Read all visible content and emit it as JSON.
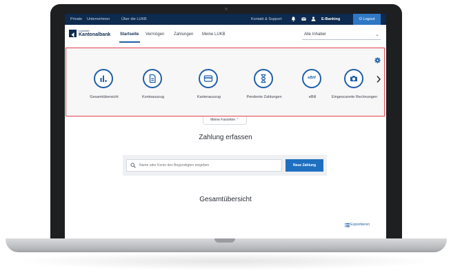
{
  "topbar": {
    "links": [
      "Private",
      "Unternehmen",
      "Über die LUKB"
    ],
    "contact": "Kontakt & Support",
    "ebanking": "E-Banking",
    "logout": "Logout"
  },
  "nav": {
    "logo_line1": "Luzerner",
    "logo_line2": "Kantonalbank",
    "items": [
      "Startseite",
      "Vermögen",
      "Zahlungen",
      "Meine LUKB"
    ],
    "active": "Startseite",
    "owner_select": "Alle Inhaber"
  },
  "shortcuts": [
    {
      "label": "Gesamtübersicht",
      "icon": "bar-chart-icon"
    },
    {
      "label": "Kontoauszug",
      "icon": "document-icon"
    },
    {
      "label": "Kartenauszug",
      "icon": "credit-card-icon"
    },
    {
      "label": "Pendente Zahlungen",
      "icon": "hourglass-icon"
    },
    {
      "label": "eBill",
      "icon": "ebill-icon",
      "icon_text": "eBill"
    },
    {
      "label": "Eingescannte Rechnungen",
      "icon": "camera-icon"
    }
  ],
  "favorites": "Meine Favoriten",
  "payment": {
    "title": "Zahlung erfassen",
    "search_placeholder": "Name oder Konto des Begünstigten eingeben",
    "new_payment": "Neue Zahlung"
  },
  "overview": {
    "title": "Gesamtübersicht",
    "export": "Exportieren"
  },
  "colors": {
    "brand_navy": "#0d2a4f",
    "accent_blue": "#1f5ea8",
    "button_blue": "#1f6fc0",
    "highlight_red": "#e0424c"
  }
}
